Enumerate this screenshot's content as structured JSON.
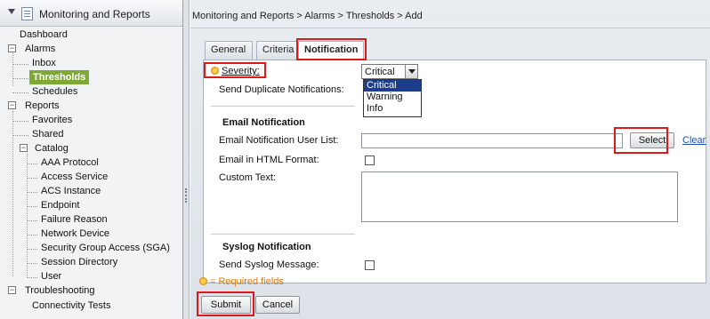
{
  "sidebar": {
    "title": "Monitoring and Reports",
    "items": {
      "dashboard": "Dashboard",
      "alarms": "Alarms",
      "inbox": "Inbox",
      "thresholds": "Thresholds",
      "schedules": "Schedules",
      "reports": "Reports",
      "favorites": "Favorites",
      "shared": "Shared",
      "catalog": "Catalog",
      "aaa_protocol": "AAA Protocol",
      "access_service": "Access Service",
      "acs_instance": "ACS Instance",
      "endpoint": "Endpoint",
      "failure_reason": "Failure Reason",
      "network_device": "Network Device",
      "sga": "Security Group Access (SGA)",
      "session_directory": "Session Directory",
      "user": "User",
      "troubleshooting": "Troubleshooting",
      "connectivity_tests": "Connectivity Tests"
    },
    "expander_minus": "−"
  },
  "breadcrumb": "Monitoring and Reports > Alarms > Thresholds > Add",
  "tabs": {
    "general": "General",
    "criteria": "Criteria",
    "notification": "Notification"
  },
  "form": {
    "severity_label": "Severity:",
    "severity_value": "Critical",
    "severity_options": [
      "Critical",
      "Warning",
      "Info"
    ],
    "send_duplicate_label": "Send Duplicate Notifications:",
    "email_header": "Email Notification",
    "email_user_list_label": "Email Notification User List:",
    "email_user_list_value": "",
    "select_button": "Select",
    "clear_link": "Clear",
    "email_html_label": "Email in HTML Format:",
    "email_html_checked": false,
    "custom_text_label": "Custom Text:",
    "custom_text_value": "",
    "syslog_header": "Syslog Notification",
    "send_syslog_label": "Send Syslog Message:",
    "send_syslog_checked": false
  },
  "required_note": "= Required fields",
  "buttons": {
    "submit": "Submit",
    "cancel": "Cancel"
  },
  "colors": {
    "selected_tree_item": "#7fa936",
    "highlight": "#e01818",
    "link": "#1f4fa8",
    "required": "#d97a10"
  },
  "icons": [
    "chevron-down-icon",
    "reports-app-icon",
    "expander-minus-icon",
    "required-star-icon",
    "dropdown-arrow-icon"
  ]
}
